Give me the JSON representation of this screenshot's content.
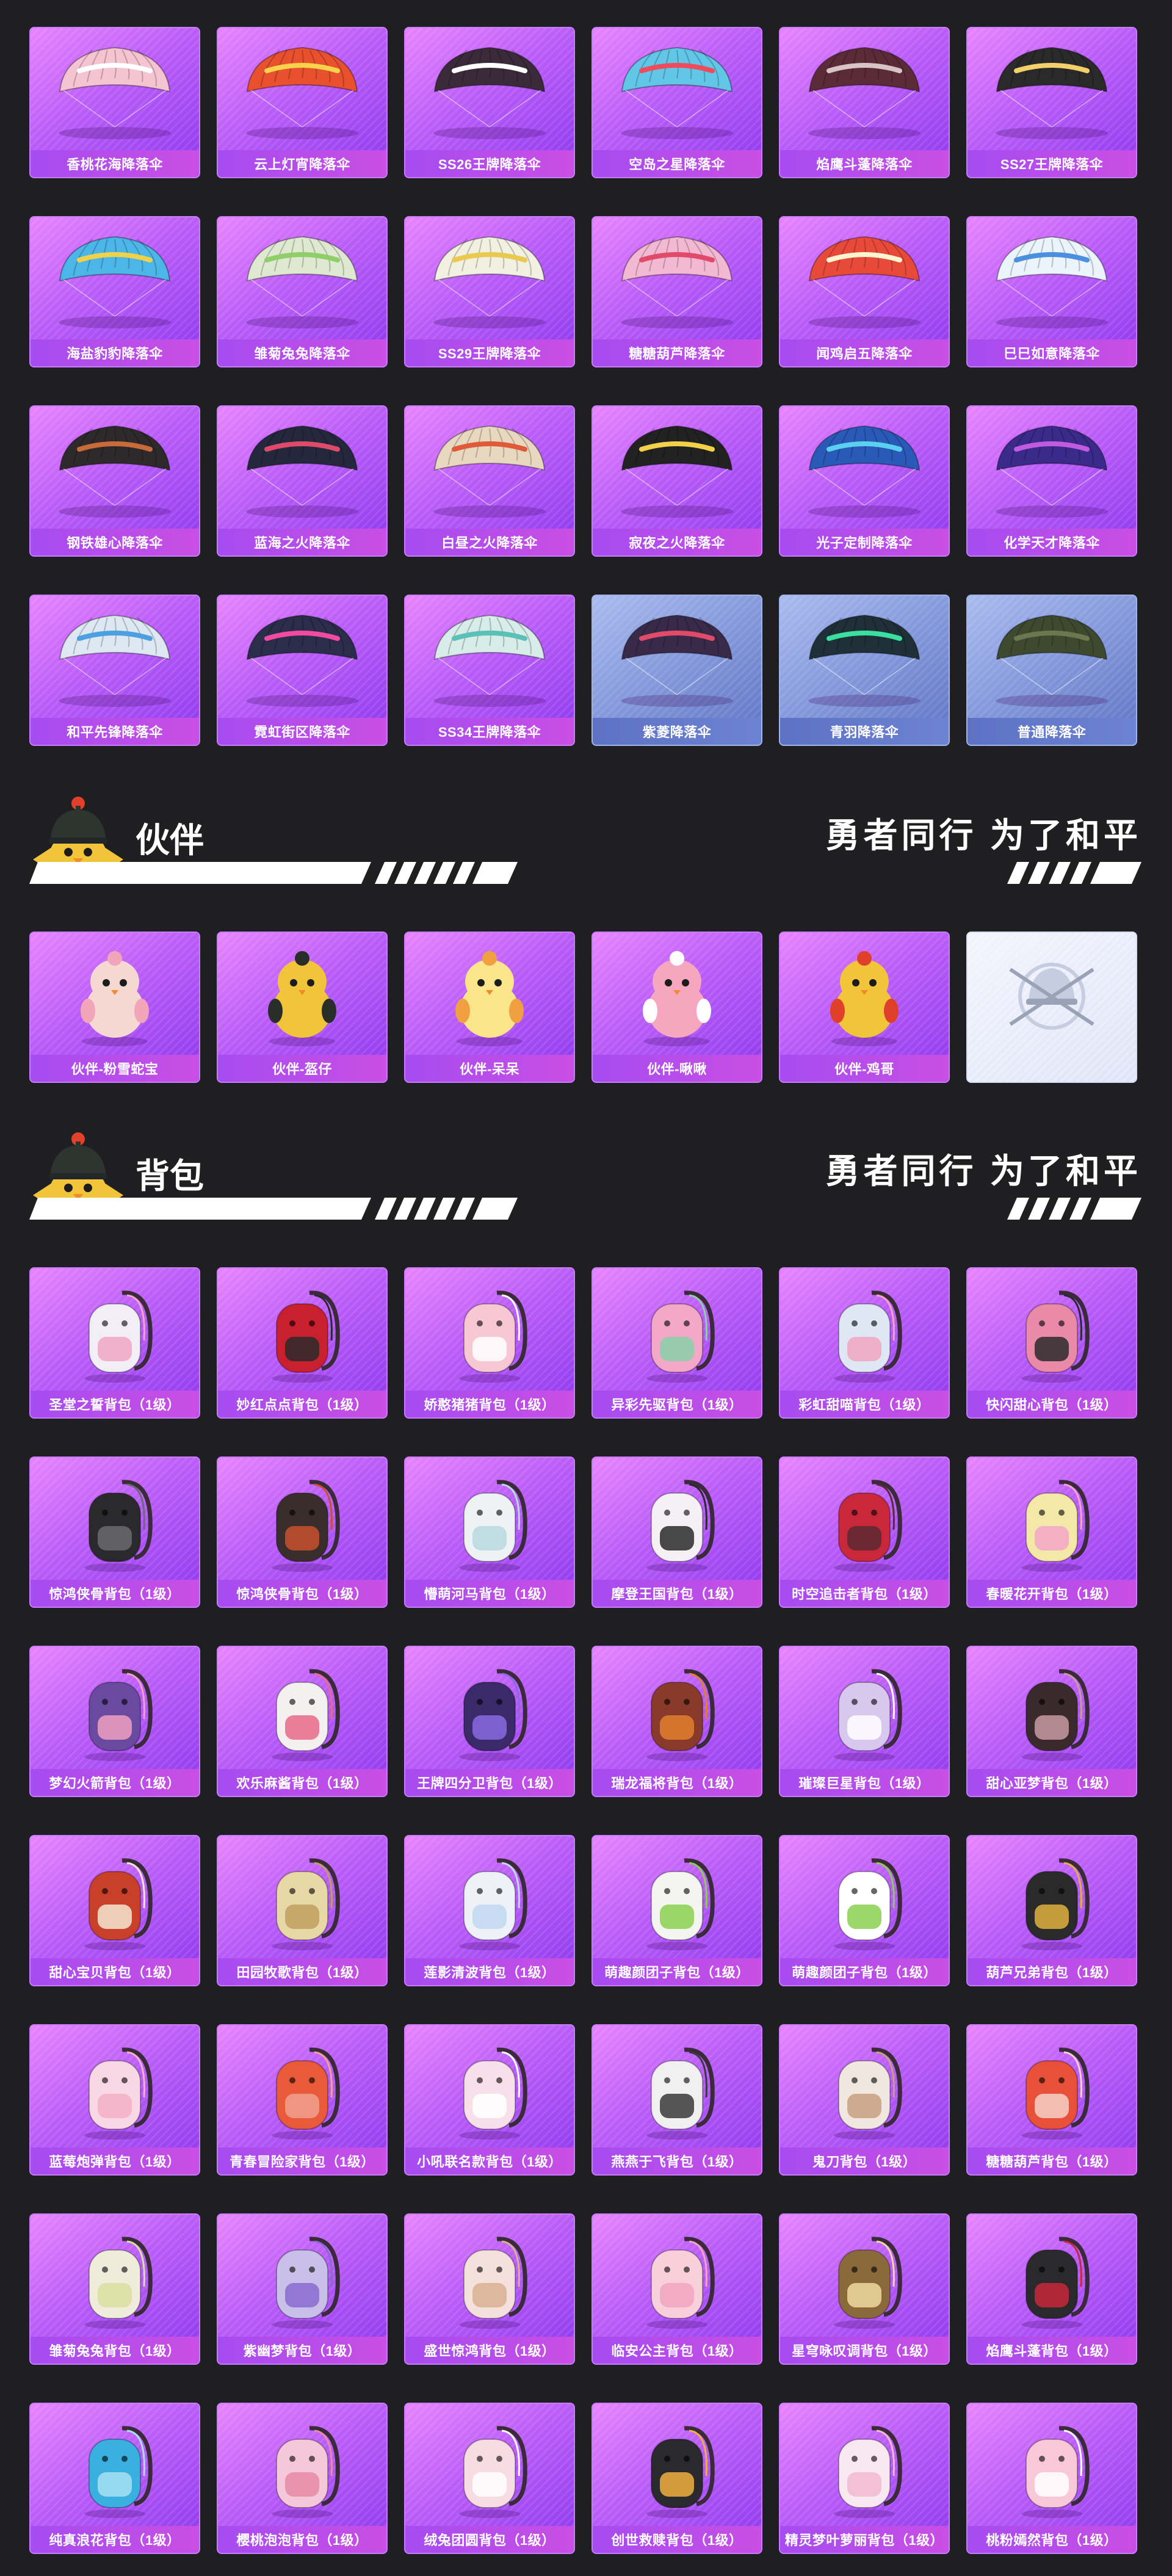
{
  "parachutes": [
    {
      "name": "香桃花海降落伞",
      "theme": "purple",
      "canopy": "#f4c4d2",
      "accent": "#ffffff"
    },
    {
      "name": "云上灯宵降落伞",
      "theme": "purple",
      "canopy": "#e8502e",
      "accent": "#f7d24a"
    },
    {
      "name": "SS26王牌降落伞",
      "theme": "purple",
      "canopy": "#3b2b3a",
      "accent": "#ffffff"
    },
    {
      "name": "空岛之星降落伞",
      "theme": "purple",
      "canopy": "#62c6e6",
      "accent": "#f04b5c"
    },
    {
      "name": "焰鹰斗蓬降落伞",
      "theme": "purple",
      "canopy": "#5b2b3a",
      "accent": "#d8c4c8"
    },
    {
      "name": "SS27王牌降落伞",
      "theme": "purple",
      "canopy": "#2a2a2a",
      "accent": "#f4d06a"
    },
    {
      "name": "海盐豹豹降落伞",
      "theme": "purple",
      "canopy": "#4db6e8",
      "accent": "#f0d24a"
    },
    {
      "name": "雏菊兔兔降落伞",
      "theme": "purple",
      "canopy": "#dfe8d0",
      "accent": "#8fcf6a"
    },
    {
      "name": "SS29王牌降落伞",
      "theme": "purple",
      "canopy": "#f2f0e0",
      "accent": "#e9c94e"
    },
    {
      "name": "糖糖葫芦降落伞",
      "theme": "purple",
      "canopy": "#f3b9d2",
      "accent": "#e24a6a"
    },
    {
      "name": "闻鸡启五降落伞",
      "theme": "purple",
      "canopy": "#e84a3a",
      "accent": "#fff4d0"
    },
    {
      "name": "巳巳如意降落伞",
      "theme": "purple",
      "canopy": "#eaf4fa",
      "accent": "#4a8fe0"
    },
    {
      "name": "钢铁雄心降落伞",
      "theme": "purple",
      "canopy": "#2e2a2c",
      "accent": "#c86a3a"
    },
    {
      "name": "蓝海之火降落伞",
      "theme": "purple",
      "canopy": "#24283c",
      "accent": "#e04a6a"
    },
    {
      "name": "白昼之火降落伞",
      "theme": "purple",
      "canopy": "#e8d8c0",
      "accent": "#e05a3a"
    },
    {
      "name": "寂夜之火降落伞",
      "theme": "purple",
      "canopy": "#222222",
      "accent": "#f2d048"
    },
    {
      "name": "光子定制降落伞",
      "theme": "purple",
      "canopy": "#2a5ab8",
      "accent": "#5ad0f0"
    },
    {
      "name": "化学天才降落伞",
      "theme": "purple",
      "canopy": "#3a2a8a",
      "accent": "#c05ae0"
    },
    {
      "name": "和平先锋降落伞",
      "theme": "purple",
      "canopy": "#dde8f2",
      "accent": "#4aa0e0"
    },
    {
      "name": "霓虹街区降落伞",
      "theme": "purple",
      "canopy": "#2a2e4a",
      "accent": "#f24aa0"
    },
    {
      "name": "SS34王牌降落伞",
      "theme": "purple",
      "canopy": "#d8ecea",
      "accent": "#5ac0b8"
    },
    {
      "name": "紫菱降落伞",
      "theme": "blue",
      "canopy": "#3a2a4a",
      "accent": "#e24a6a"
    },
    {
      "name": "青羽降落伞",
      "theme": "blue",
      "canopy": "#1f3038",
      "accent": "#3ae0a0"
    },
    {
      "name": "普通降落伞",
      "theme": "blue",
      "canopy": "#3e4a30",
      "accent": "#6a7850"
    }
  ],
  "companion_section": {
    "title": "伙伴",
    "slogan": "勇者同行 为了和平"
  },
  "companions": [
    {
      "name": "伙伴-粉雪蛇宝",
      "theme": "purple",
      "body": "#f6d8d2",
      "accent": "#f2a4b8"
    },
    {
      "name": "伙伴-盔仔",
      "theme": "purple",
      "body": "#f2c43a",
      "accent": "#2a2e2a"
    },
    {
      "name": "伙伴-呆呆",
      "theme": "purple",
      "body": "#fbe58a",
      "accent": "#f0a040"
    },
    {
      "name": "伙伴-啾啾",
      "theme": "purple",
      "body": "#f7a6c0",
      "accent": "#ffffff"
    },
    {
      "name": "伙伴-鸡哥",
      "theme": "purple",
      "body": "#f2c43a",
      "accent": "#e0402a"
    },
    {
      "name": "",
      "theme": "white",
      "body": "#c7cde0",
      "accent": "#9aa2b8"
    }
  ],
  "backpack_section": {
    "title": "背包",
    "slogan": "勇者同行 为了和平"
  },
  "backpacks": [
    {
      "name": "圣堂之誓背包（1级）",
      "body": "#f2eef6",
      "accent": "#f2a4c8"
    },
    {
      "name": "妙红点点背包（1级）",
      "body": "#c8202e",
      "accent": "#2a2a2a"
    },
    {
      "name": "娇憨猪猪背包（1级）",
      "body": "#f7c8d4",
      "accent": "#ffffff"
    },
    {
      "name": "异彩先驱背包（1级）",
      "body": "#f4a8c8",
      "accent": "#8ad0a8"
    },
    {
      "name": "彩虹甜喵背包（1级）",
      "body": "#dfe6f4",
      "accent": "#f2a4c0"
    },
    {
      "name": "快闪甜心背包（1级）",
      "body": "#e88aa8",
      "accent": "#2a2a2a"
    },
    {
      "name": "惊鸿侠骨背包（1级）",
      "body": "#2a2a2c",
      "accent": "#6a6a70"
    },
    {
      "name": "惊鸿侠骨背包（1级）",
      "body": "#3a2e2c",
      "accent": "#c8502e"
    },
    {
      "name": "懵萌河马背包（1级）",
      "body": "#eef2f2",
      "accent": "#b8d8e0"
    },
    {
      "name": "摩登王国背包（1级）",
      "body": "#f4f0f4",
      "accent": "#2a2a2a"
    },
    {
      "name": "时空追击者背包（1级）",
      "body": "#c8283a",
      "accent": "#5a2a30"
    },
    {
      "name": "春暖花开背包（1级）",
      "body": "#f4e8a8",
      "accent": "#f2a4c8"
    },
    {
      "name": "梦幻火箭背包（1级）",
      "body": "#6a4aa0",
      "accent": "#f0a0c0"
    },
    {
      "name": "欢乐麻酱背包（1级）",
      "body": "#f4f0f0",
      "accent": "#e86a8a"
    },
    {
      "name": "王牌四分卫背包（1级）",
      "body": "#3a2a6a",
      "accent": "#8a6ae0"
    },
    {
      "name": "瑞龙福将背包（1级）",
      "body": "#8a3a2a",
      "accent": "#e0802e"
    },
    {
      "name": "璀璨巨星背包（1级）",
      "body": "#d8c8f0",
      "accent": "#ffffff"
    },
    {
      "name": "甜心亚梦背包（1级）",
      "body": "#3a2a2e",
      "accent": "#c89aa0"
    },
    {
      "name": "甜心宝贝背包（1级）",
      "body": "#c8402a",
      "accent": "#f4e8d0"
    },
    {
      "name": "田园牧歌背包（1级）",
      "body": "#e8d8a8",
      "accent": "#c0a060"
    },
    {
      "name": "莲影清波背包（1级）",
      "body": "#eef2f8",
      "accent": "#c0d8f0"
    },
    {
      "name": "萌趣颜团子背包（1级）",
      "body": "#f4f4f0",
      "accent": "#8ad050"
    },
    {
      "name": "萌趣颜团子背包（1级）",
      "body": "#ffffff",
      "accent": "#8ad050"
    },
    {
      "name": "葫芦兄弟背包（1级）",
      "body": "#2a2a2a",
      "accent": "#e0b040"
    },
    {
      "name": "蓝莓炮弹背包（1级）",
      "body": "#f8d8e4",
      "accent": "#f4b0c8"
    },
    {
      "name": "青春冒险家背包（1级）",
      "body": "#e85a3a",
      "accent": "#f2a090"
    },
    {
      "name": "小吼联名款背包（1级）",
      "body": "#f8e0ea",
      "accent": "#ffffff"
    },
    {
      "name": "燕燕于飞背包（1级）",
      "body": "#f0f0f0",
      "accent": "#3a3a3a"
    },
    {
      "name": "鬼刀背包（1级）",
      "body": "#f0e8e0",
      "accent": "#c8a080"
    },
    {
      "name": "糖糖葫芦背包（1级）",
      "body": "#e8503a",
      "accent": "#f4d0c8"
    },
    {
      "name": "雏菊兔兔背包（1级）",
      "body": "#f0ecdc",
      "accent": "#d8e0a0"
    },
    {
      "name": "紫幽梦背包（1级）",
      "body": "#c8c0e8",
      "accent": "#8a6ad0"
    },
    {
      "name": "盛世惊鸿背包（1级）",
      "body": "#f4e0dc",
      "accent": "#d8b090"
    },
    {
      "name": "临安公主背包（1级）",
      "body": "#f8d0dc",
      "accent": "#f2a4c0"
    },
    {
      "name": "星穹咏叹调背包（1级）",
      "body": "#8a6a3a",
      "accent": "#f0d8a0"
    },
    {
      "name": "焰鹰斗蓬背包（1级）",
      "body": "#2a2a2c",
      "accent": "#c8283a"
    },
    {
      "name": "纯真浪花背包（1级）",
      "body": "#3ab0e0",
      "accent": "#a8e0f0"
    },
    {
      "name": "樱桃泡泡背包（1级）",
      "body": "#f4c8d8",
      "accent": "#e88aa8"
    },
    {
      "name": "绒兔团圆背包（1级）",
      "body": "#f8dce4",
      "accent": "#ffffff"
    },
    {
      "name": "创世救赎背包（1级）",
      "body": "#2a2a2e",
      "accent": "#f0b040"
    },
    {
      "name": "精灵梦叶萝丽背包（1级）",
      "body": "#f8e8f0",
      "accent": "#f2b8d0"
    },
    {
      "name": "桃粉嫣然背包（1级）",
      "body": "#f8c8d8",
      "accent": "#ffffff"
    }
  ]
}
